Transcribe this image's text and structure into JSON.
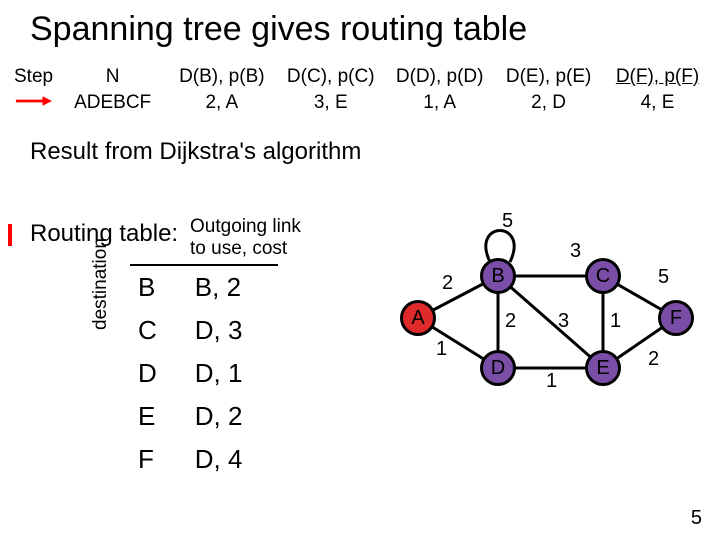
{
  "title": "Spanning tree gives routing table",
  "top_table": {
    "headers": {
      "step": "Step",
      "n": "N",
      "c0": "D(B), p(B)",
      "c1": "D(C), p(C)",
      "c2": "D(D), p(D)",
      "c3": "D(E), p(E)",
      "c4": "D(F), p(F)"
    },
    "row": {
      "n": "ADEBCF",
      "c0": "2, A",
      "c1": "3, E",
      "c2": "1, A",
      "c3": "2, D",
      "c4": "4, E"
    }
  },
  "result_text": "Result from Dijkstra's algorithm",
  "routing_label": "Routing table:",
  "routing_table": {
    "header": "Outgoing link\nto use, cost",
    "rows": [
      {
        "dest": "B",
        "out": "B, 2"
      },
      {
        "dest": "C",
        "out": "D, 3"
      },
      {
        "dest": "D",
        "out": "D, 1"
      },
      {
        "dest": "E",
        "out": "D, 2"
      },
      {
        "dest": "F",
        "out": "D, 4"
      }
    ],
    "axis_label": "destination"
  },
  "graph": {
    "nodes": {
      "A": "A",
      "B": "B",
      "C": "C",
      "D": "D",
      "E": "E",
      "F": "F"
    },
    "edge_labels": {
      "AB": "2",
      "AD": "1",
      "BC": "3",
      "BD": "2",
      "loopB": "5",
      "CE": "1",
      "CF": "5",
      "DE": "1",
      "EF": "2",
      "DC_or_BE": "3"
    }
  },
  "slide_number": "5",
  "chart_data": {
    "type": "table",
    "tables": [
      {
        "name": "dijkstra_step",
        "columns": [
          "Step",
          "N",
          "D(B),p(B)",
          "D(C),p(C)",
          "D(D),p(D)",
          "D(E),p(E)",
          "D(F),p(F)"
        ],
        "rows": [
          [
            "→",
            "ADEBCF",
            "2,A",
            "3,E",
            "1,A",
            "2,D",
            "4,E"
          ]
        ]
      },
      {
        "name": "routing_table",
        "columns": [
          "destination",
          "Outgoing link to use, cost"
        ],
        "rows": [
          [
            "B",
            "B,2"
          ],
          [
            "C",
            "D,3"
          ],
          [
            "D",
            "D,1"
          ],
          [
            "E",
            "D,2"
          ],
          [
            "F",
            "D,4"
          ]
        ]
      }
    ],
    "graph": {
      "nodes": [
        "A",
        "B",
        "C",
        "D",
        "E",
        "F"
      ],
      "edges": [
        {
          "u": "A",
          "v": "B",
          "w": 2
        },
        {
          "u": "A",
          "v": "D",
          "w": 1
        },
        {
          "u": "B",
          "v": "C",
          "w": 3
        },
        {
          "u": "B",
          "v": "D",
          "w": 2
        },
        {
          "u": "B",
          "v": "B",
          "w": 5
        },
        {
          "u": "C",
          "v": "E",
          "w": 1
        },
        {
          "u": "C",
          "v": "F",
          "w": 5
        },
        {
          "u": "D",
          "v": "E",
          "w": 1
        },
        {
          "u": "E",
          "v": "F",
          "w": 2
        },
        {
          "u": "B",
          "v": "E",
          "w": 3
        }
      ]
    }
  }
}
